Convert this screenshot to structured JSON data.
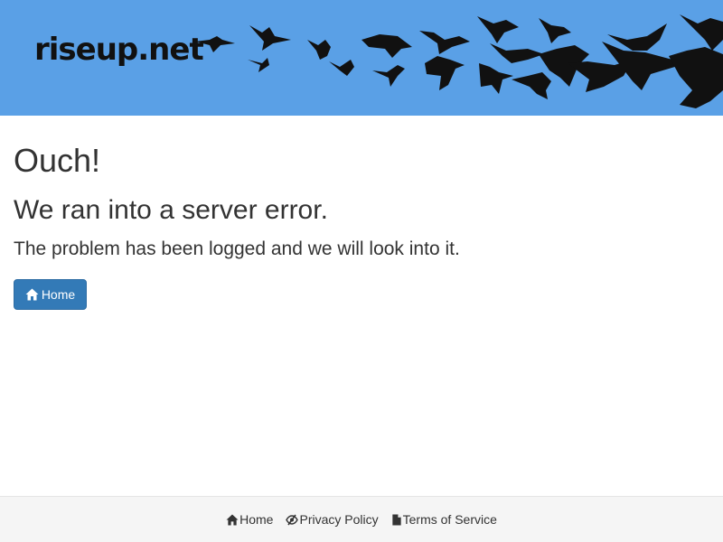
{
  "header": {
    "logo_text": "riseup.net",
    "background_color": "#5aa0e6",
    "decoration": "flying-birds-silhouettes"
  },
  "main": {
    "title": "Ouch!",
    "subtitle": "We ran into a server error.",
    "message": "The problem has been logged and we will look into it.",
    "home_button": {
      "label": "Home",
      "icon": "home-icon",
      "color": "#337ab7"
    }
  },
  "footer": {
    "links": [
      {
        "label": "Home",
        "icon": "home-icon"
      },
      {
        "label": "Privacy Policy",
        "icon": "eye-slash-icon"
      },
      {
        "label": "Terms of Service",
        "icon": "file-icon"
      }
    ]
  }
}
